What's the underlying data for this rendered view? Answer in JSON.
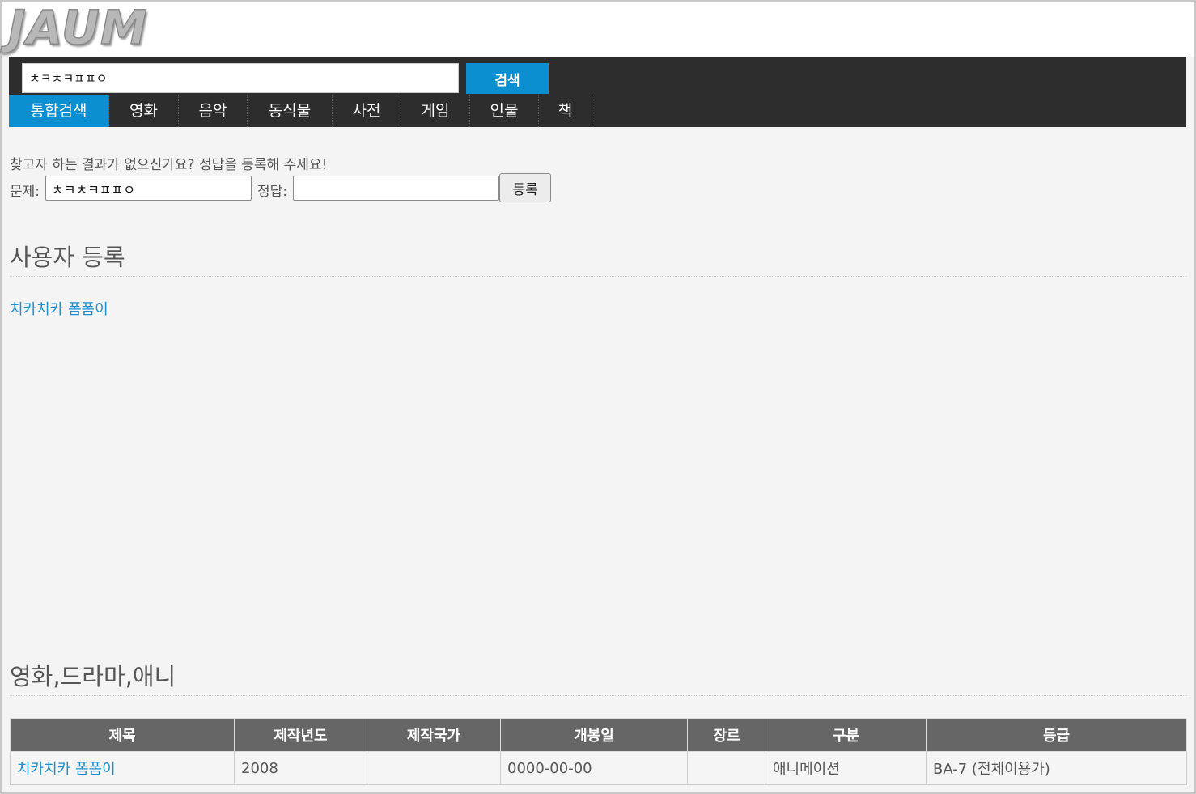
{
  "brand": {
    "logo_text": "JAUM"
  },
  "search": {
    "value": "ㅊㅋㅊㅋㅍㅍㅇ",
    "button_label": "검색"
  },
  "tabs": [
    {
      "label": "통합검색",
      "active": true
    },
    {
      "label": "영화"
    },
    {
      "label": "음악"
    },
    {
      "label": "동식물"
    },
    {
      "label": "사전"
    },
    {
      "label": "게임"
    },
    {
      "label": "인물"
    },
    {
      "label": "책"
    }
  ],
  "answer_form": {
    "notice": "찾고자 하는 결과가 없으신가요? 정답을 등록해 주세요!",
    "question_label": "문제:",
    "question_value": "ㅊㅋㅊㅋㅍㅍㅇ",
    "answer_label": "정답:",
    "answer_value": "",
    "submit_label": "등록"
  },
  "user_section": {
    "title": "사용자 등록",
    "link": "치카치카 폼폼이"
  },
  "movie_section": {
    "title": "영화,드라마,애니",
    "columns": [
      "제목",
      "제작년도",
      "제작국가",
      "개봉일",
      "장르",
      "구분",
      "등급"
    ],
    "rows": [
      [
        "치카치카 폼폼이",
        "2008",
        "",
        "0000-00-00",
        "",
        "애니메이션",
        "BA-7 (전체이용가)"
      ]
    ]
  },
  "colors": {
    "accent": "#0b8fd0",
    "header_bg": "#2d2d2d",
    "table_header": "#666666",
    "link": "#1a8fd1"
  }
}
